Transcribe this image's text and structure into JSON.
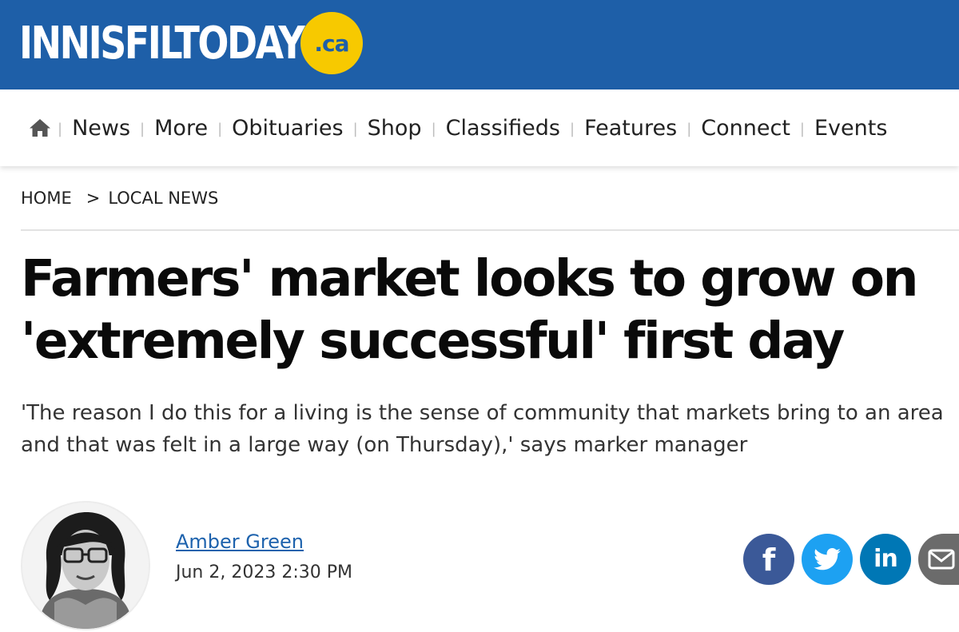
{
  "site": {
    "logo_text": "INNISFILTODAY",
    "logo_badge": ".ca",
    "brand_color": "#1e5fa8",
    "badge_color": "#f7c900"
  },
  "nav": {
    "home_icon": "home-icon",
    "items": [
      {
        "label": "News"
      },
      {
        "label": "More"
      },
      {
        "label": "Obituaries"
      },
      {
        "label": "Shop"
      },
      {
        "label": "Classifieds"
      },
      {
        "label": "Features"
      },
      {
        "label": "Connect"
      },
      {
        "label": "Events"
      }
    ],
    "separator": "|"
  },
  "breadcrumb": {
    "home": "HOME",
    "separator": ">",
    "section": "LOCAL NEWS"
  },
  "article": {
    "headline_line1": "Farmers' market looks to grow on",
    "headline_line2": "'extremely successful' first day",
    "deck_line1": "'The reason I do this for a living is the sense of community that markets bring to an area",
    "deck_line2": "and that was felt in a large way (on Thursday),' says marker manager",
    "author": "Amber Green",
    "date": "Jun 2, 2023 2:30 PM"
  },
  "share": {
    "facebook": {
      "icon": "facebook-icon",
      "color": "#3b5998",
      "glyph": "f"
    },
    "twitter": {
      "icon": "twitter-icon",
      "color": "#1da1f2"
    },
    "linkedin": {
      "icon": "linkedin-icon",
      "color": "#0077b5",
      "glyph": "in"
    },
    "email": {
      "icon": "email-icon",
      "color": "#6b6b6b"
    }
  }
}
